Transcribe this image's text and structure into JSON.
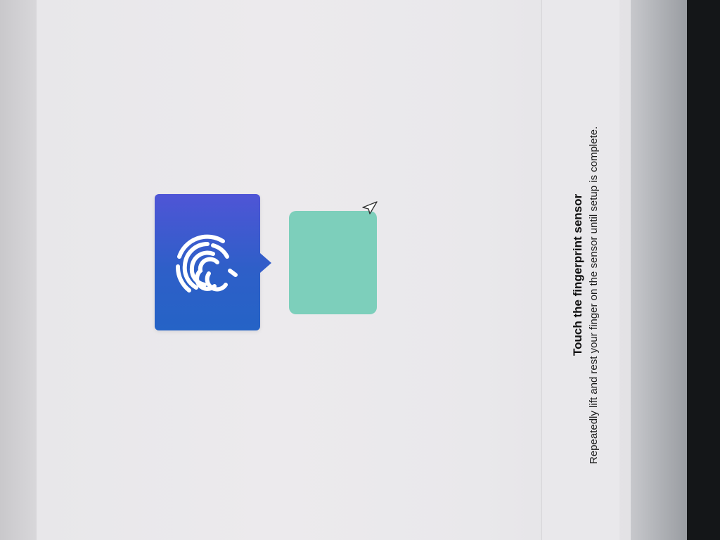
{
  "setup": {
    "title": "Touch the fingerprint sensor",
    "instruction": "Repeatedly lift and rest your finger on the sensor until setup is complete."
  },
  "icons": {
    "fingerprint": "fingerprint-icon",
    "cursor": "mouse-pointer-icon"
  },
  "colors": {
    "fingerprint_card": "#2e5fc8",
    "sensor_card": "#7dcfbb",
    "background": "#e8e7ea"
  }
}
